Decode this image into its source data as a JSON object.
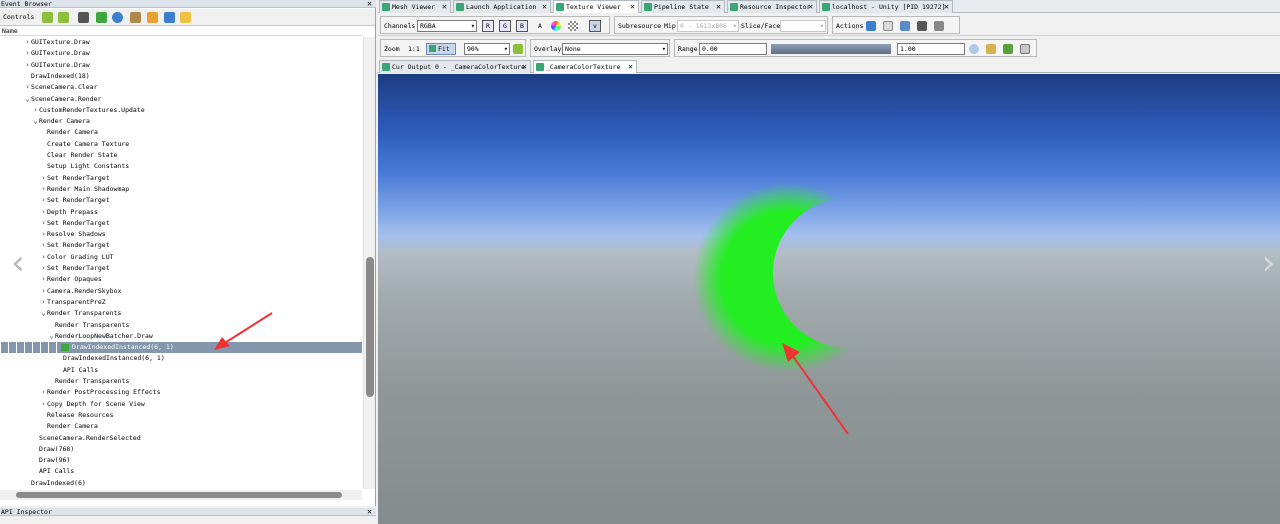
{
  "event_browser": {
    "title": "Event Browser",
    "controls_label": "Controls",
    "column_header": "Name",
    "rows": [
      {
        "label": "GUITexture.Draw",
        "indent": 3,
        "toggle": ">"
      },
      {
        "label": "GUITexture.Draw",
        "indent": 3,
        "toggle": ">"
      },
      {
        "label": "GUITexture.Draw",
        "indent": 3,
        "toggle": ">"
      },
      {
        "label": "DrawIndexed(18)",
        "indent": 3,
        "toggle": ""
      },
      {
        "label": "SceneCamera.Clear",
        "indent": 3,
        "toggle": ">"
      },
      {
        "label": "SceneCamera.Render",
        "indent": 3,
        "toggle": "v"
      },
      {
        "label": "CustomRenderTextures.Update",
        "indent": 4,
        "toggle": ">"
      },
      {
        "label": "Render Camera",
        "indent": 4,
        "toggle": "v"
      },
      {
        "label": "Render Camera",
        "indent": 5,
        "toggle": ""
      },
      {
        "label": "Create Camera Texture",
        "indent": 5,
        "toggle": ""
      },
      {
        "label": "Clear Render State",
        "indent": 5,
        "toggle": ""
      },
      {
        "label": "Setup Light Constants",
        "indent": 5,
        "toggle": ""
      },
      {
        "label": "Set RenderTarget",
        "indent": 5,
        "toggle": ">"
      },
      {
        "label": "Render Main Shadowmap",
        "indent": 5,
        "toggle": ">"
      },
      {
        "label": "Set RenderTarget",
        "indent": 5,
        "toggle": ">"
      },
      {
        "label": "Depth Prepass",
        "indent": 5,
        "toggle": ">"
      },
      {
        "label": "Set RenderTarget",
        "indent": 5,
        "toggle": ">"
      },
      {
        "label": "Resolve Shadows",
        "indent": 5,
        "toggle": ">"
      },
      {
        "label": "Set RenderTarget",
        "indent": 5,
        "toggle": ">"
      },
      {
        "label": "Color Grading LUT",
        "indent": 5,
        "toggle": ">"
      },
      {
        "label": "Set RenderTarget",
        "indent": 5,
        "toggle": ">"
      },
      {
        "label": "Render Opaques",
        "indent": 5,
        "toggle": ">"
      },
      {
        "label": "Camera.RenderSkybox",
        "indent": 5,
        "toggle": ">"
      },
      {
        "label": "TransparentPreZ",
        "indent": 5,
        "toggle": ">"
      },
      {
        "label": "Render Transparents",
        "indent": 5,
        "toggle": "v"
      },
      {
        "label": "Render Transparents",
        "indent": 6,
        "toggle": ""
      },
      {
        "label": "RenderLoopNewBatcher.Draw",
        "indent": 6,
        "toggle": "v"
      },
      {
        "label": "DrawIndexedInstanced(6, 1)",
        "indent": 9,
        "toggle": "",
        "selected": true
      },
      {
        "label": "DrawIndexedInstanced(6, 1)",
        "indent": 7,
        "toggle": ""
      },
      {
        "label": "API Calls",
        "indent": 7,
        "toggle": ""
      },
      {
        "label": "Render Transparents",
        "indent": 6,
        "toggle": ""
      },
      {
        "label": "Render PostProcessing Effects",
        "indent": 5,
        "toggle": ">"
      },
      {
        "label": "Copy Depth for Scene View",
        "indent": 5,
        "toggle": ">"
      },
      {
        "label": "Release Resources",
        "indent": 5,
        "toggle": ""
      },
      {
        "label": "Render Camera",
        "indent": 5,
        "toggle": ""
      },
      {
        "label": "SceneCamera.RenderSelected",
        "indent": 4,
        "toggle": ""
      },
      {
        "label": "Draw(768)",
        "indent": 4,
        "toggle": ""
      },
      {
        "label": "Draw(96)",
        "indent": 4,
        "toggle": ""
      },
      {
        "label": "API Calls",
        "indent": 4,
        "toggle": ""
      },
      {
        "label": "DrawIndexed(6)",
        "indent": 3,
        "toggle": ""
      }
    ]
  },
  "api_inspector": {
    "title": "API Inspector"
  },
  "top_tabs": [
    {
      "label": "Mesh Viewer",
      "active": false
    },
    {
      "label": "Launch Application",
      "active": false
    },
    {
      "label": "Texture Viewer",
      "active": true
    },
    {
      "label": "Pipeline State",
      "active": false
    },
    {
      "label": "Resource Inspector",
      "active": false
    },
    {
      "label": "localhost - Unity [PID 19272]",
      "active": false
    }
  ],
  "toolbar1": {
    "channels_label": "Channels",
    "channels_value": "RGBA",
    "r": "R",
    "g": "G",
    "b": "B",
    "a": "A",
    "subresource_label": "Subresource",
    "mip_label": "Mip",
    "mip_value": "0 - 1613x806",
    "slice_label": "Slice/Face",
    "actions_label": "Actions"
  },
  "toolbar2": {
    "zoom_label": "Zoom",
    "zoom_1to1": "1:1",
    "fit_label": "Fit",
    "zoom_value": "90%",
    "overlay_label": "Overlay",
    "overlay_value": "None",
    "range_label": "Range",
    "range_min": "0.00",
    "range_max": "1.00"
  },
  "texture_tabs": [
    {
      "label": "Cur Output 0 - _CameraColorTexture",
      "active": false
    },
    {
      "label": "_CameraColorTexture",
      "active": true
    }
  ],
  "colors": {
    "accent": "#3aa676",
    "moon": "#22ee22",
    "selection": "#8497ad",
    "arrow": "#ee3333"
  }
}
